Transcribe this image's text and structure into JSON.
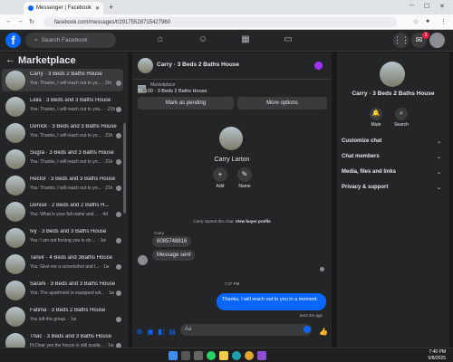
{
  "browser": {
    "tab_title": "Messenger | Facebook",
    "url": "facebook.com/messages/t/29175528715427960",
    "new_tab": "+"
  },
  "fb": {
    "search_placeholder": "Search Facebook",
    "notifications_count": "2"
  },
  "sidebar": {
    "title": "Marketplace",
    "conversations": [
      {
        "name": "Carry · 3 Beds 2 Baths House",
        "snippet": "You: Thanks, I will reach out to yo... · 2m",
        "active": true
      },
      {
        "name": "Leila · 3 Beds and 3 Baths House",
        "snippet": "You: Thanks, I will reach out to you... · 21h"
      },
      {
        "name": "Derrick · 3 Beds and 3 Baths House",
        "snippet": "You: Thanks, I will reach out to yo... · 21h"
      },
      {
        "name": "Sugra · 3 Beds and 3 Baths House",
        "snippet": "You: Thanks, I will reach out to yo... · 21h"
      },
      {
        "name": "Hector · 3 Beds and 3 Baths House",
        "snippet": "You: Thanks, I will reach out to yo... · 21h"
      },
      {
        "name": "Denise · 2 Beds and 2 Baths H...",
        "snippet": "You: What is your full name and ... · 4d"
      },
      {
        "name": "Ivy · 3 Beds and 3 Baths House",
        "snippet": "You: I am not forcing you to do ... · 1w"
      },
      {
        "name": "Tanvir · 4 Beds and 3Baths House",
        "snippet": "You: Give me a screenshot and I... · 1w"
      },
      {
        "name": "Sarahi · 3 Beds and 3 Baths House",
        "snippet": "You: The apartment is equipped wit... · 1w"
      },
      {
        "name": "Fatima · 3 Beds 2 Baths House",
        "snippet": "You left the group. · 1w"
      },
      {
        "name": "Thac · 3 Beds and 3 Baths House",
        "snippet": "Hi Dear yes the house is still availa... · 1w"
      }
    ]
  },
  "chat": {
    "header_title": "Carry · 3 Beds 2 Baths House",
    "listing_label": "Marketplace",
    "listing_price_title": "$1,100 · 3 Beds 2 Baths House",
    "mark_pending": "Mark as pending",
    "more_options": "More options",
    "profile_name": "Carry Larton",
    "add_label": "Add",
    "name_label": "Name",
    "started_text": "Carry started this chat.",
    "view_buyer": "View buyer profile",
    "sender_name": "Carry",
    "msg1": "6085748816",
    "msg2": "Message sent",
    "timestamp": "7:37 PM",
    "outgoing": "Thanks, I will reach out to you in a moment.",
    "sent_status": "Sent 2m ago",
    "composer_placeholder": "Aa"
  },
  "details": {
    "name": "Carry · 3 Beds 2 Baths House",
    "mute": "Mute",
    "search": "Search",
    "sections": [
      "Customize chat",
      "Chat members",
      "Media, files and links",
      "Privacy & support"
    ]
  },
  "taskbar": {
    "time": "7:40 PM",
    "date": "5/8/2025"
  }
}
